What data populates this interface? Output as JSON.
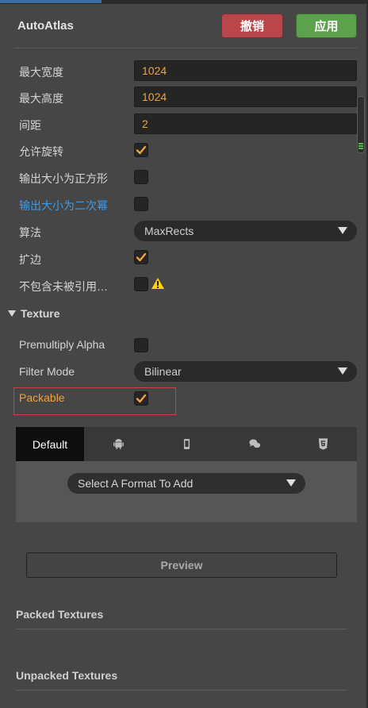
{
  "header": {
    "title": "AutoAtlas",
    "cancel_label": "撤销",
    "apply_label": "应用"
  },
  "settings": [
    {
      "label": "最大宽度",
      "value": "1024"
    },
    {
      "label": "最大高度",
      "value": "1024"
    },
    {
      "label": "间距",
      "value": "2"
    },
    {
      "label": "允许旋转",
      "checked": true
    },
    {
      "label": "输出大小为正方形",
      "checked": false
    },
    {
      "label": "输出大小为二次幂",
      "checked": false
    },
    {
      "label": "算法",
      "selected": "MaxRects"
    },
    {
      "label": "扩边",
      "checked": true
    },
    {
      "label": "不包含未被引用…",
      "checked": false,
      "icon": "warning-icon"
    }
  ],
  "texture": {
    "section_title": "Texture",
    "premultiply_label": "Premultiply Alpha",
    "premultiply_checked": false,
    "filter_label": "Filter Mode",
    "filter_value": "Bilinear",
    "packable_label": "Packable",
    "packable_checked": true
  },
  "platforms": {
    "tabs": [
      {
        "label": "Default",
        "icon": null
      },
      {
        "label": "",
        "icon": "android-icon"
      },
      {
        "label": "",
        "icon": "mobile-icon"
      },
      {
        "label": "",
        "icon": "chat-icon"
      },
      {
        "label": "",
        "icon": "html5-icon"
      }
    ],
    "format_placeholder": "Select A Format To Add"
  },
  "preview_label": "Preview",
  "packed_textures_title": "Packed Textures",
  "unpacked_textures_title": "Unpacked Textures",
  "colors": {
    "accent_value": "#f0a23c",
    "highlight_label": "#3d9ae8",
    "cancel": "#b9464a",
    "apply": "#5ca14b",
    "warning": "#ffd400"
  }
}
